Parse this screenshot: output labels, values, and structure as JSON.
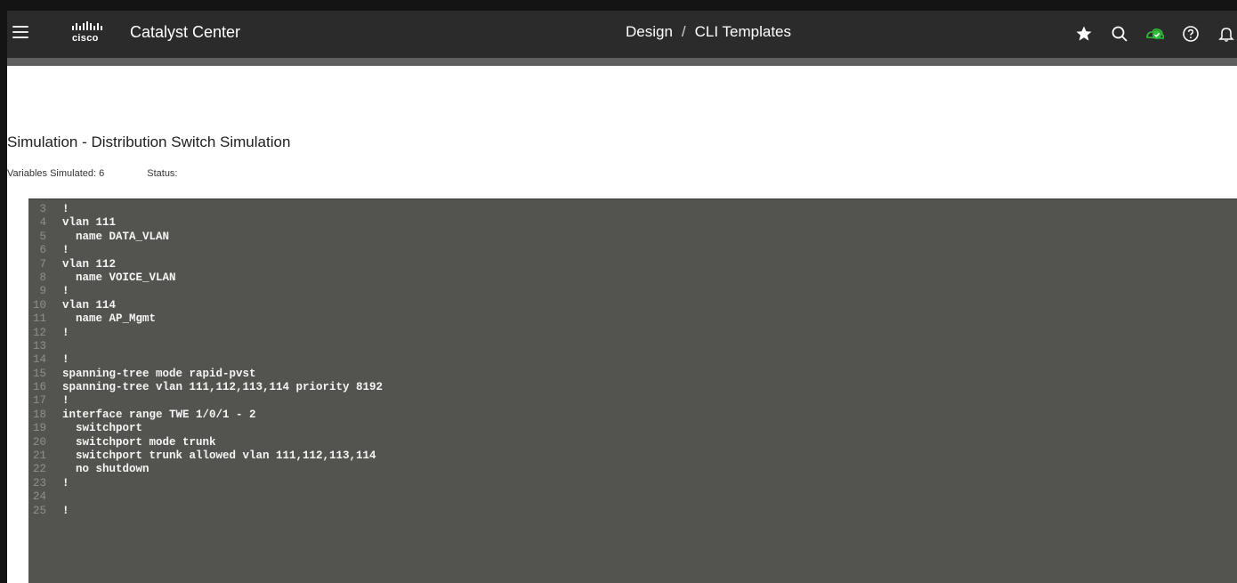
{
  "header": {
    "app_title": "Catalyst Center",
    "logo_text": "cisco",
    "breadcrumb": [
      "Design",
      "/",
      "CLI Templates"
    ],
    "icons": [
      "star-icon",
      "search-icon",
      "health-status-icon",
      "help-icon",
      "bell-icon"
    ],
    "health_color": "#2fbf3a"
  },
  "main": {
    "title": "Simulation - Distribution Switch Simulation",
    "variables_label": "Variables Simulated: 6",
    "status_label": "Status:"
  },
  "editor": {
    "lines": [
      {
        "n": "3",
        "text": "!"
      },
      {
        "n": "4",
        "text": "vlan 111"
      },
      {
        "n": "5",
        "text": "  name DATA_VLAN"
      },
      {
        "n": "6",
        "text": "!"
      },
      {
        "n": "7",
        "text": "vlan 112"
      },
      {
        "n": "8",
        "text": "  name VOICE_VLAN"
      },
      {
        "n": "9",
        "text": "!"
      },
      {
        "n": "10",
        "text": "vlan 114"
      },
      {
        "n": "11",
        "text": "  name AP_Mgmt"
      },
      {
        "n": "12",
        "text": "!"
      },
      {
        "n": "13",
        "text": ""
      },
      {
        "n": "14",
        "text": "!"
      },
      {
        "n": "15",
        "text": "spanning-tree mode rapid-pvst"
      },
      {
        "n": "16",
        "text": "spanning-tree vlan 111,112,113,114 priority 8192"
      },
      {
        "n": "17",
        "text": "!"
      },
      {
        "n": "18",
        "text": "interface range TWE 1/0/1 - 2"
      },
      {
        "n": "19",
        "text": "  switchport"
      },
      {
        "n": "20",
        "text": "  switchport mode trunk"
      },
      {
        "n": "21",
        "text": "  switchport trunk allowed vlan 111,112,113,114"
      },
      {
        "n": "22",
        "text": "  no shutdown"
      },
      {
        "n": "23",
        "text": "!"
      },
      {
        "n": "24",
        "text": ""
      },
      {
        "n": "25",
        "text": "!"
      }
    ]
  }
}
